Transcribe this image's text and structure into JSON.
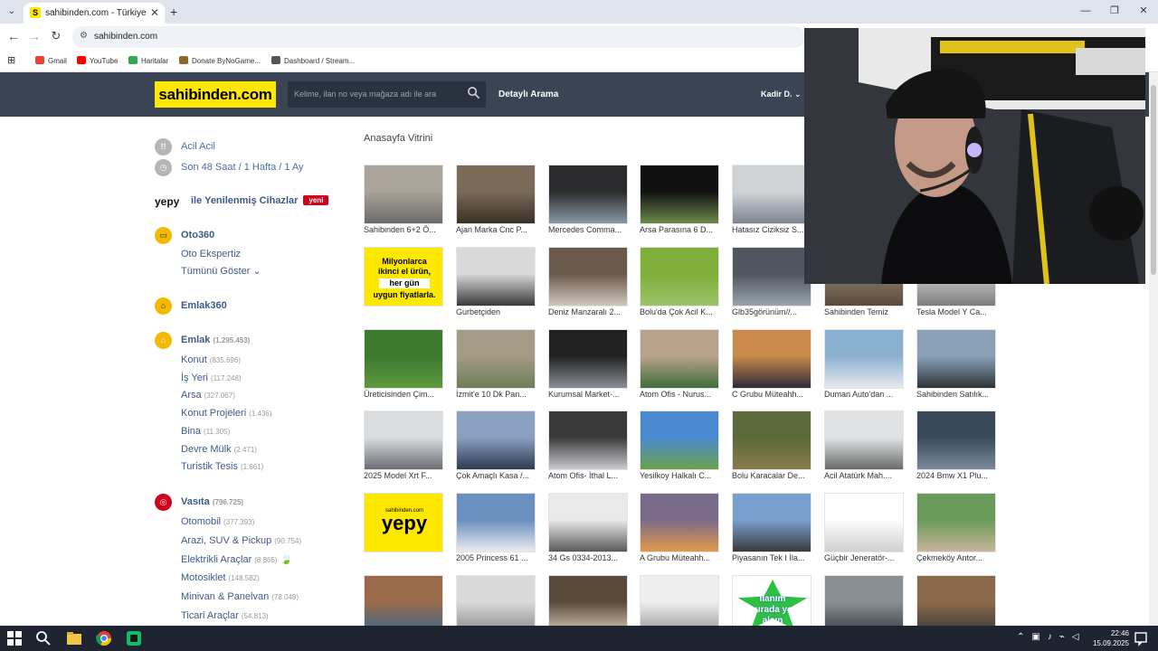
{
  "browser": {
    "tab_title": "sahibinden.com - Türkiye'nin Online",
    "url": "sahibinden.com",
    "bookmarks": [
      {
        "label": "Gmail",
        "color": "#ea4335"
      },
      {
        "label": "YouTube",
        "color": "#ff0000"
      },
      {
        "label": "Haritalar",
        "color": "#34a853"
      },
      {
        "label": "Donate ByNoGame...",
        "color": "#8a6a2a"
      },
      {
        "label": "Dashboard / Stream...",
        "color": "#555555"
      }
    ]
  },
  "header": {
    "logo": "sahibinden.com",
    "search_placeholder": "Kelime, ilan no veya mağaza adı ile ara",
    "advanced_search": "Detaylı Arama",
    "user": "Kadir D."
  },
  "sidebar": {
    "acil": "Acil Acil",
    "recent": "Son 48 Saat / 1 Hafta / 1 Ay",
    "yepy_brand": "yepy",
    "yepy_text": "ile Yenilenmiş Cihazlar",
    "yepy_badge": "yeni",
    "oto360": "Oto360",
    "oto_ekspertiz": "Oto Ekspertiz",
    "show_all": "Tümünü Göster",
    "emlak360": "Emlak360",
    "emlak": {
      "label": "Emlak",
      "count": "(1.295.453)"
    },
    "emlak_items": [
      {
        "label": "Konut",
        "count": "(835.696)"
      },
      {
        "label": "İş Yeri",
        "count": "(117.248)"
      },
      {
        "label": "Arsa",
        "count": "(327.067)"
      },
      {
        "label": "Konut Projeleri",
        "count": "(1.436)"
      },
      {
        "label": "Bina",
        "count": "(11.305)"
      },
      {
        "label": "Devre Mülk",
        "count": "(2.471)"
      },
      {
        "label": "Turistik Tesis",
        "count": "(1.661)"
      }
    ],
    "vasita": {
      "label": "Vasıta",
      "count": "(796.725)"
    },
    "vasita_items": [
      {
        "label": "Otomobil",
        "count": "(377.393)"
      },
      {
        "label": "Arazi, SUV & Pickup",
        "count": "(90.754)"
      },
      {
        "label": "Elektrikli Araçlar",
        "count": "(8.865)"
      },
      {
        "label": "Motosiklet",
        "count": "(148.582)"
      },
      {
        "label": "Minivan & Panelvan",
        "count": "(78.049)"
      },
      {
        "label": "Ticari Araçlar",
        "count": "(54.813)"
      }
    ]
  },
  "main": {
    "title": "Anasayfa Vitrini",
    "banner_text_1": "Milyonlarca",
    "banner_text_2": "ikinci el ürün,",
    "banner_text_3": "her gün",
    "banner_text_4": "uygun fiyatlarla.",
    "yepy_banner_small": "sahibinden.com",
    "yepy_banner_big": "yepy",
    "ilan_banner": "İlanım burada yer alsın",
    "rows": [
      [
        "Sahibinden 6+2 Ö...",
        "Ajan Marka Cnc P...",
        "Mercedes Comma...",
        "Arsa Parasına 6 D...",
        "Hatasız Ciziksiz S...",
        "",
        ""
      ],
      [
        "",
        "Gurbetçiden",
        "Deniz Manzaralı 2...",
        "Bolu'da Çok Acil K...",
        "Glb35görünüm//...",
        "Sahibinden Temiz",
        "Tesla Model Y Ca..."
      ],
      [
        "Üreticisinden Çim...",
        "İzmit'e 10 Dk Pan...",
        "Kurumsal Market-...",
        "Atom Ofis - Nurus...",
        "C Grubu Müteahh...",
        "Duman Auto'dan ...",
        "Sahibinden Satılık..."
      ],
      [
        "2025 Model Xrt F...",
        "Çok Amaçlı Kasa /...",
        "Atom Ofis- İthal L...",
        "Yesilkoy Halkalı C...",
        "Bolu Karacalar De...",
        "Acil Atatürk Mah....",
        "2024 Bmw X1 Plu..."
      ],
      [
        "",
        "2005 Princess 61 ...",
        "34 Gs 0334-2013...",
        "A Grubu Müteahh...",
        "Piyasanın Tek I İla...",
        "Güçbir Jeneratör-...",
        "Çekmeköy Antor..."
      ],
      [
        "",
        "",
        "",
        "",
        "",
        "",
        ""
      ]
    ]
  },
  "taskbar": {
    "time": "22:46",
    "date": "15.09.2025"
  }
}
